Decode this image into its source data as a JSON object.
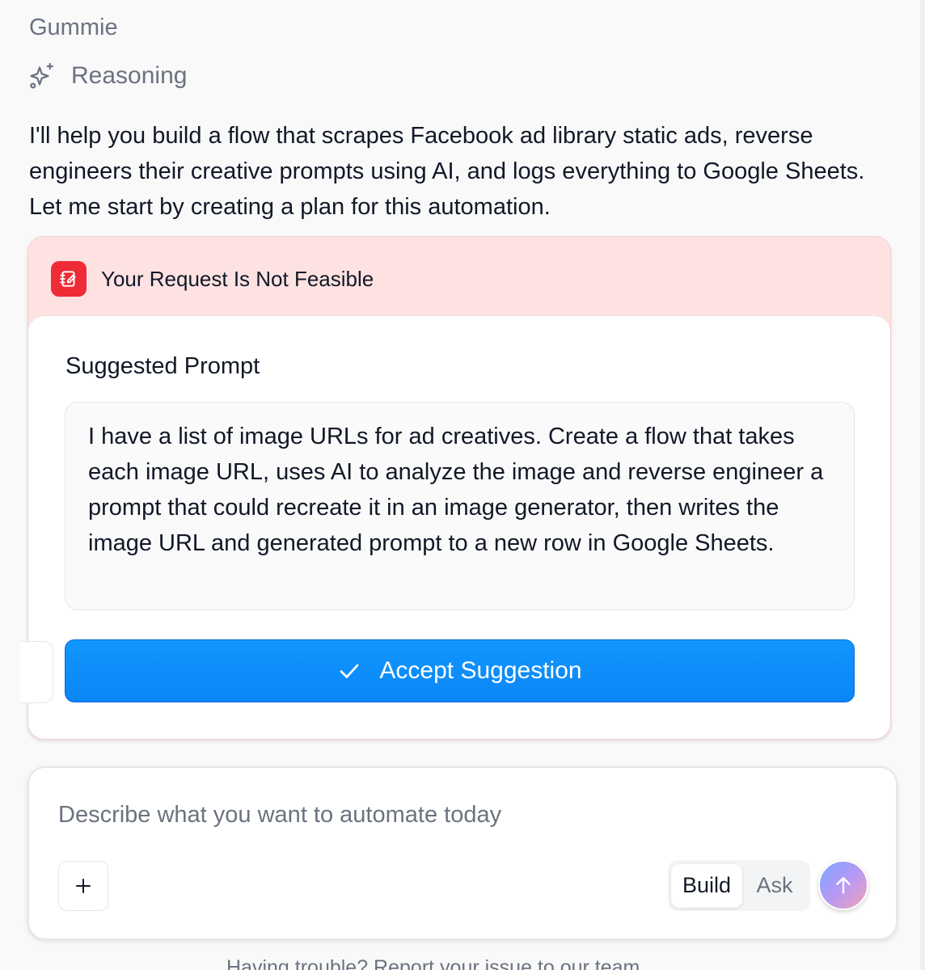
{
  "chat": {
    "sender": "Gummie",
    "reasoning_label": "Reasoning",
    "message": "I'll help you build a flow that scrapes Facebook ad library static ads, reverse engineers their creative prompts using AI, and logs everything to Google Sheets. Let me start by creating a plan for this automation."
  },
  "card": {
    "title": "Your Request Is Not Feasible",
    "suggested_label": "Suggested Prompt",
    "suggested_prompt": "I have a list of image URLs for ad creatives. Create a flow that takes each image URL, uses AI to analyze the image and reverse engineer a prompt that could recreate it in an image generator, then writes the image URL and generated prompt to a new row in Google Sheets.",
    "accept_label": "Accept Suggestion"
  },
  "composer": {
    "placeholder": "Describe what you want to automate today",
    "value": "",
    "modes": [
      "Build",
      "Ask"
    ],
    "selected_mode": "Build"
  },
  "footer": {
    "hint": "Having trouble?  Report your issue to our team"
  },
  "colors": {
    "accent_blue": "#0a86f5",
    "alert_red": "#ef2b35",
    "alert_bg": "#fee2e2"
  }
}
